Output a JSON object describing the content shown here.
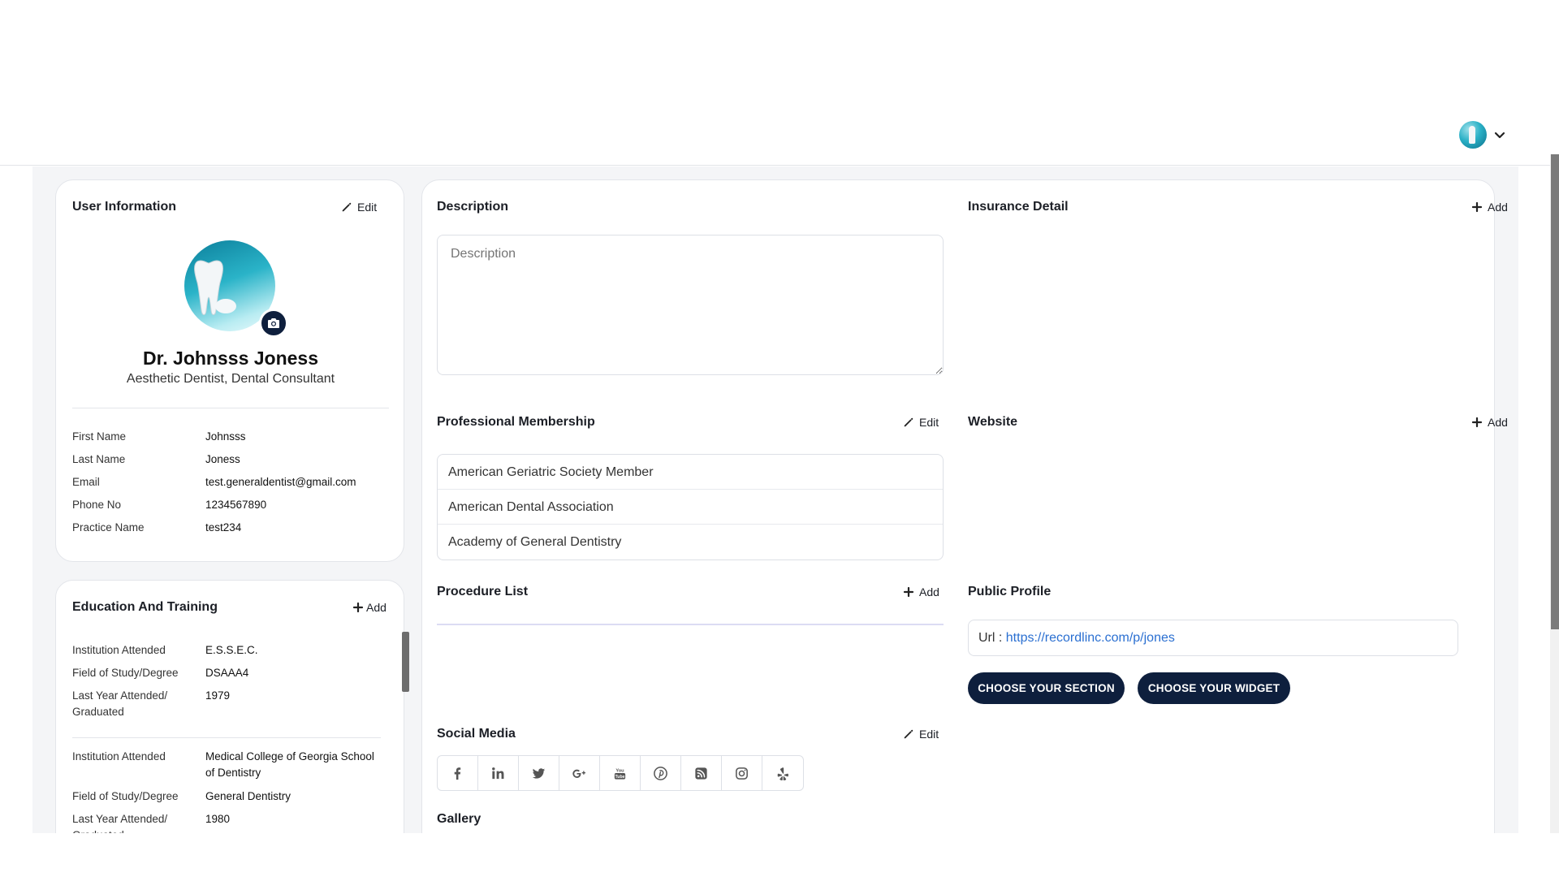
{
  "user_info": {
    "title": "User Information",
    "edit_label": "Edit",
    "name": "Dr. Johnsss Joness",
    "specialty": "Aesthetic Dentist, Dental Consultant",
    "fields": [
      {
        "label": "First Name",
        "value": "Johnsss"
      },
      {
        "label": "Last Name",
        "value": "Joness"
      },
      {
        "label": "Email",
        "value": "test.generaldentist@gmail.com"
      },
      {
        "label": "Phone No",
        "value": "1234567890"
      },
      {
        "label": "Practice Name",
        "value": "test234"
      }
    ]
  },
  "education": {
    "title": "Education And Training",
    "add_label": "Add",
    "entries": [
      {
        "institution_label": "Institution Attended",
        "institution": "E.S.S.E.C.",
        "field_label": "Field of Study/Degree",
        "field": "DSAAA4",
        "year_label": "Last Year Attended/ Graduated",
        "year": "1979"
      },
      {
        "institution_label": "Institution Attended",
        "institution": "Medical College of Georgia School of Dentistry",
        "field_label": "Field of Study/Degree",
        "field": "General Dentistry",
        "year_label": "Last Year Attended/ Graduated",
        "year": "1980"
      }
    ]
  },
  "description": {
    "title": "Description",
    "placeholder": "Description"
  },
  "insurance": {
    "title": "Insurance Detail",
    "add_label": "Add"
  },
  "membership": {
    "title": "Professional Membership",
    "edit_label": "Edit",
    "items": [
      "American Geriatric Society Member",
      "American Dental Association",
      "Academy of General Dentistry"
    ]
  },
  "website": {
    "title": "Website",
    "add_label": "Add"
  },
  "procedures": {
    "title": "Procedure List",
    "add_label": "Add"
  },
  "public_profile": {
    "title": "Public Profile",
    "url_label": "Url : ",
    "url": "https://recordlinc.com/p/jones",
    "section_button": "CHOOSE YOUR SECTION",
    "widget_button": "CHOOSE YOUR WIDGET"
  },
  "social": {
    "title": "Social Media",
    "edit_label": "Edit",
    "icons": [
      "facebook-icon",
      "linkedin-icon",
      "twitter-icon",
      "google-plus-icon",
      "youtube-icon",
      "pinterest-icon",
      "rss-icon",
      "instagram-icon",
      "yelp-icon"
    ]
  },
  "gallery": {
    "title": "Gallery"
  },
  "colors": {
    "primary_dark": "#0e1f3d",
    "link": "#2a6fd1",
    "background": "#f4f5f7"
  }
}
